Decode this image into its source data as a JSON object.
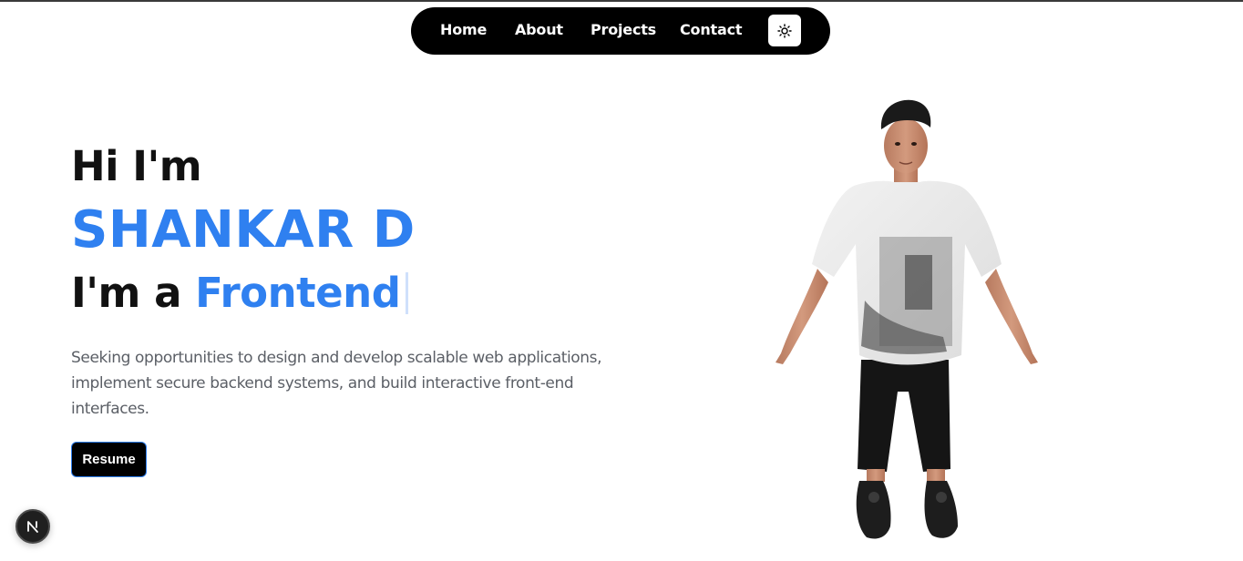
{
  "nav": {
    "links": [
      {
        "label": "Home"
      },
      {
        "label": "About"
      },
      {
        "label": "Projects"
      },
      {
        "label": "Contact"
      }
    ],
    "theme_icon": "sun-icon"
  },
  "hero": {
    "greeting": "Hi I'm",
    "name": "SHANKAR D",
    "role_prefix": "I'm a",
    "role_word": "Frontend",
    "description": "Seeking opportunities to design and develop scalable web applications, implement secure backend systems, and build interactive front-end interfaces.",
    "resume_label": "Resume"
  },
  "avatar": {
    "icon": "3d-avatar-figure"
  },
  "badge": {
    "icon": "nextjs-logo-icon"
  },
  "colors": {
    "accent": "#2f80f0",
    "nav_bg": "#000000",
    "text": "#111111",
    "muted": "#5b5f66"
  }
}
